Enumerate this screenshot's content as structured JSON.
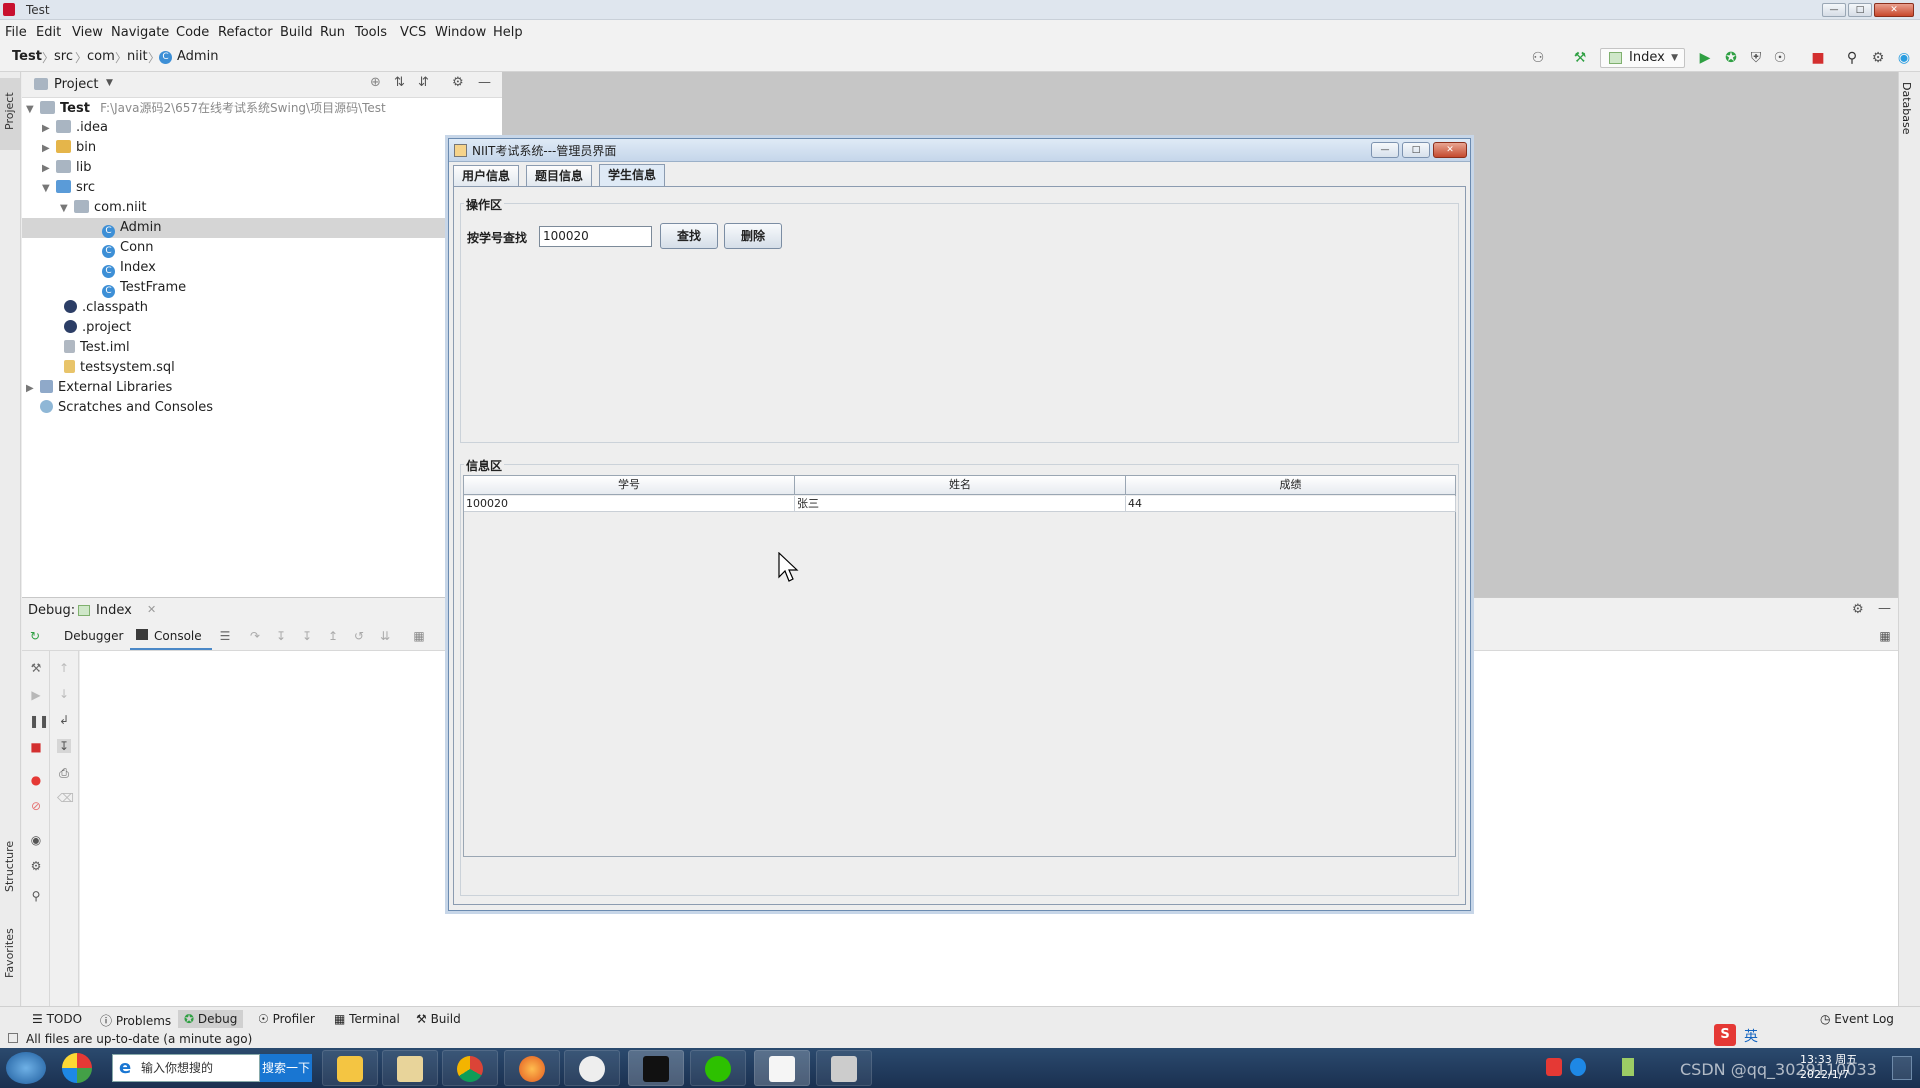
{
  "ide": {
    "window_title": "Test",
    "menu": [
      "File",
      "Edit",
      "View",
      "Navigate",
      "Code",
      "Refactor",
      "Build",
      "Run",
      "Tools",
      "VCS",
      "Window",
      "Help"
    ],
    "breadcrumb": [
      "Test",
      "src",
      "com",
      "niit",
      "Admin"
    ],
    "run_config": "Index",
    "project_label": "Project",
    "left_tabs": [
      "Project",
      "Structure",
      "Favorites"
    ],
    "right_tab": "Database",
    "tree": {
      "root_name": "Test",
      "root_path": "F:\\Java源码2\\657在线考试系统Swing\\项目源码\\Test",
      "items": [
        ".idea",
        "bin",
        "lib",
        "src",
        "com.niit",
        "Admin",
        "Conn",
        "Index",
        "TestFrame",
        ".classpath",
        ".project",
        "Test.iml",
        "testsystem.sql",
        "External Libraries",
        "Scratches and Consoles"
      ]
    },
    "debug": {
      "label": "Debug:",
      "session": "Index",
      "tabs": [
        "Debugger",
        "Console"
      ]
    },
    "bottom_tabs": [
      "TODO",
      "Problems",
      "Debug",
      "Profiler",
      "Terminal",
      "Build"
    ],
    "event_log": "Event Log",
    "status": "All files are up-to-date (a minute ago)"
  },
  "taskbar": {
    "search_placeholder": "输入你想搜的",
    "search_button": "搜索一下",
    "clock_time": "13:33 周五",
    "clock_date": "2022/1/7",
    "ime": "英",
    "watermark": "CSDN @qq_3029110033"
  },
  "dialog": {
    "title": "NIIT考试系统---管理员界面",
    "tabs": [
      "用户信息",
      "题目信息",
      "学生信息"
    ],
    "op_group": "操作区",
    "search_label": "按学号查找",
    "search_value": "100020",
    "find_button": "查找",
    "delete_button": "删除",
    "info_group": "信息区",
    "table": {
      "headers": [
        "学号",
        "姓名",
        "成绩"
      ],
      "rows": [
        [
          "100020",
          "张三",
          "44"
        ]
      ]
    }
  },
  "colors": {
    "accent": "#3d8fd6",
    "run_green": "#2fa043",
    "stop_red": "#d32f2f"
  }
}
